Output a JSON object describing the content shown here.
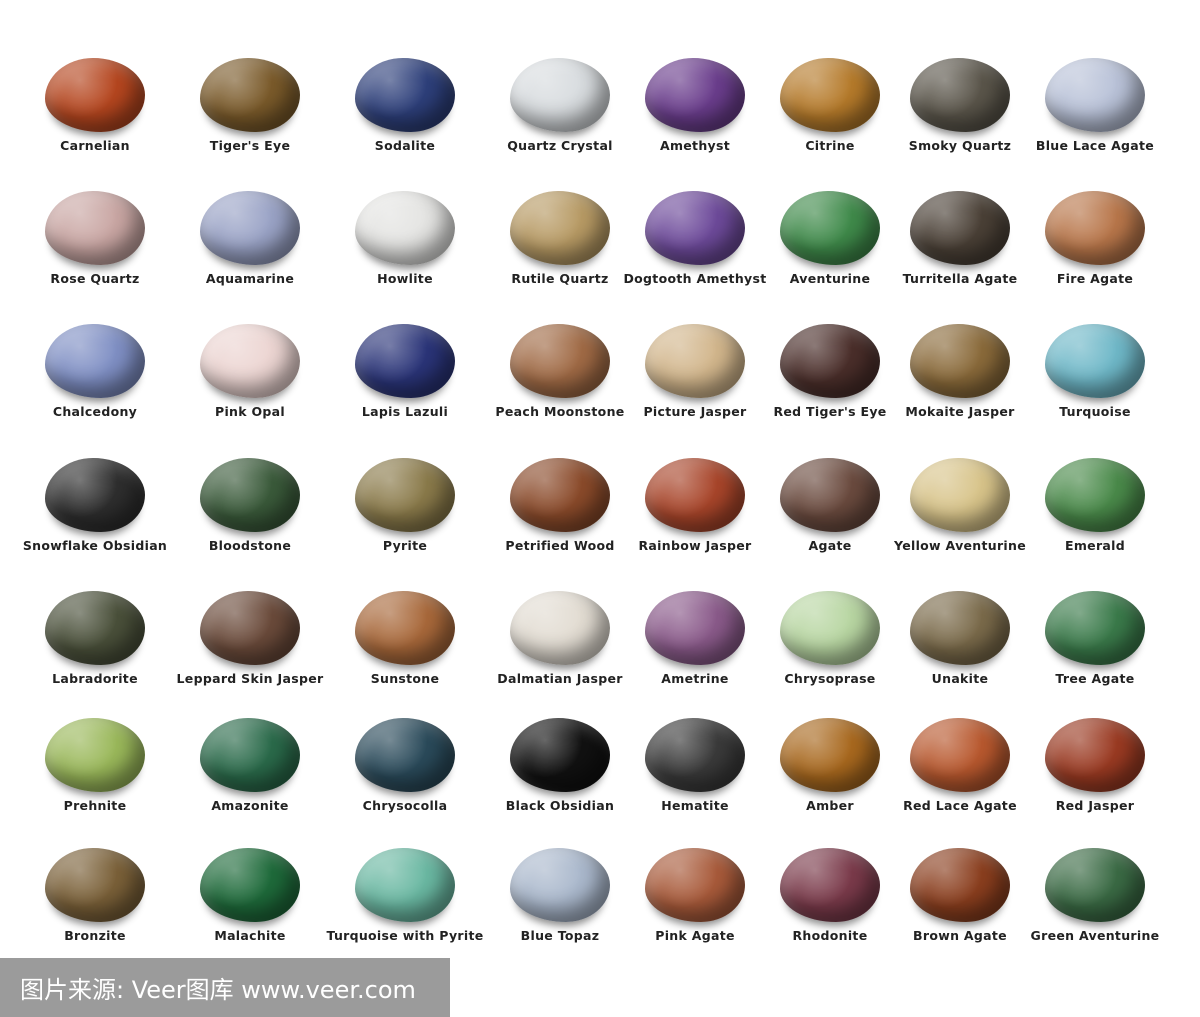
{
  "stones": [
    {
      "name": "Carnelian",
      "color": "#b5461f"
    },
    {
      "name": "Tiger's Eye",
      "color": "#7a5a2a"
    },
    {
      "name": "Sodalite",
      "color": "#2d3f7a"
    },
    {
      "name": "Quartz Crystal",
      "color": "#d8dcdf"
    },
    {
      "name": "Amethyst",
      "color": "#6a3d8c"
    },
    {
      "name": "Citrine",
      "color": "#b57a2a"
    },
    {
      "name": "Smoky Quartz",
      "color": "#5a554a"
    },
    {
      "name": "Blue Lace Agate",
      "color": "#b9c2d8"
    },
    {
      "name": "Rose Quartz",
      "color": "#c9a6a3"
    },
    {
      "name": "Aquamarine",
      "color": "#9aa3c6"
    },
    {
      "name": "Howlite",
      "color": "#e4e4e2"
    },
    {
      "name": "Rutile Quartz",
      "color": "#b79a64"
    },
    {
      "name": "Dogtooth Amethyst",
      "color": "#6d4a9a"
    },
    {
      "name": "Aventurine",
      "color": "#3f8a4a"
    },
    {
      "name": "Turritella Agate",
      "color": "#4a4036"
    },
    {
      "name": "Fire Agate",
      "color": "#b8764a"
    },
    {
      "name": "Chalcedony",
      "color": "#7f8fc4"
    },
    {
      "name": "Pink Opal",
      "color": "#ecd5d2"
    },
    {
      "name": "Lapis Lazuli",
      "color": "#2a3478"
    },
    {
      "name": "Peach Moonstone",
      "color": "#a06a45"
    },
    {
      "name": "Picture Jasper",
      "color": "#d2b68c"
    },
    {
      "name": "Red Tiger's Eye",
      "color": "#4a2e2a"
    },
    {
      "name": "Mokaite Jasper",
      "color": "#8a6a3a"
    },
    {
      "name": "Turquoise",
      "color": "#6fb8c8"
    },
    {
      "name": "Snowflake Obsidian",
      "color": "#2e2e2e"
    },
    {
      "name": "Bloodstone",
      "color": "#3a5a3a"
    },
    {
      "name": "Pyrite",
      "color": "#8a7a4a"
    },
    {
      "name": "Petrified Wood",
      "color": "#8a4a2a"
    },
    {
      "name": "Rainbow Jasper",
      "color": "#a8452a"
    },
    {
      "name": "Agate",
      "color": "#6a4a3e"
    },
    {
      "name": "Yellow Aventurine",
      "color": "#d8c48a"
    },
    {
      "name": "Emerald",
      "color": "#4a8a4a"
    },
    {
      "name": "Labradorite",
      "color": "#4a503a"
    },
    {
      "name": "Leppard Skin Jasper",
      "color": "#6a4a3a"
    },
    {
      "name": "Sunstone",
      "color": "#a8683a"
    },
    {
      "name": "Dalmatian Jasper",
      "color": "#e2dcd2"
    },
    {
      "name": "Ametrine",
      "color": "#8a5a8a"
    },
    {
      "name": "Chrysoprase",
      "color": "#b8d6a2"
    },
    {
      "name": "Unakite",
      "color": "#7a6a4a"
    },
    {
      "name": "Tree Agate",
      "color": "#3a7a4a"
    },
    {
      "name": "Prehnite",
      "color": "#9ab85a"
    },
    {
      "name": "Amazonite",
      "color": "#2a6a4a"
    },
    {
      "name": "Chrysocolla",
      "color": "#2a4a5a"
    },
    {
      "name": "Black Obsidian",
      "color": "#111111"
    },
    {
      "name": "Hematite",
      "color": "#3a3a3a"
    },
    {
      "name": "Amber",
      "color": "#a8681e"
    },
    {
      "name": "Red Lace Agate",
      "color": "#b8582e"
    },
    {
      "name": "Red Jasper",
      "color": "#9a3a22"
    },
    {
      "name": "Bronzite",
      "color": "#7a6038"
    },
    {
      "name": "Malachite",
      "color": "#1e6a3a"
    },
    {
      "name": "Turquoise with Pyrite",
      "color": "#6ab8a2"
    },
    {
      "name": "Blue Topaz",
      "color": "#aab8cc"
    },
    {
      "name": "Pink Agate",
      "color": "#a85a3a"
    },
    {
      "name": "Rhodonite",
      "color": "#7a3a4a"
    },
    {
      "name": "Brown Agate",
      "color": "#8a3e1e"
    },
    {
      "name": "Green Aventurine",
      "color": "#3a6a44"
    }
  ],
  "watermark": "图片来源: Veer图库 www.veer.com"
}
